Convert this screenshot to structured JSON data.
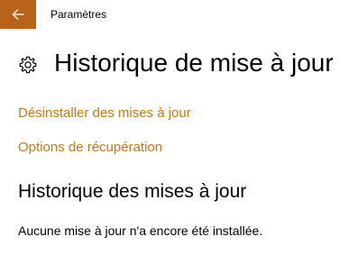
{
  "window": {
    "app_title": "Paramètres",
    "back_icon": "back-arrow-icon",
    "accent_color": "#b8631a"
  },
  "page": {
    "settings_icon": "gear-icon",
    "title": "Historique de mise à jour"
  },
  "links": {
    "uninstall_label": "Désinstaller des mises à jour",
    "recovery_label": "Options de récupération",
    "color": "#c77714"
  },
  "history": {
    "section_title": "Historique des mises à jour",
    "empty_message": "Aucune mise à jour n'a encore été installée."
  }
}
